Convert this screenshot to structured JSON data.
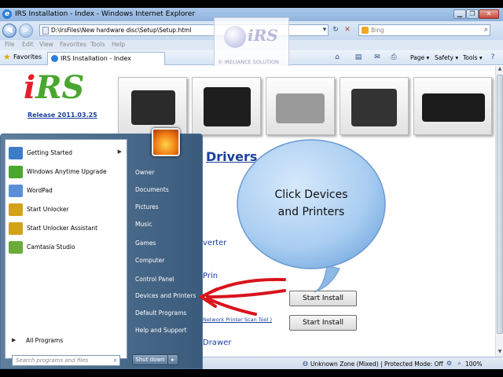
{
  "window": {
    "title": "IRS Installation - Index - Windows Internet Explorer",
    "minimize_glyph": "▁",
    "maximize_glyph": "❐",
    "close_glyph": "✕"
  },
  "address_bar": {
    "url": "D:\\IrsFiles\\New hardware disc\\Setup\\Setup.html",
    "back_glyph": "◀",
    "forward_glyph": "▶",
    "search_placeholder": "Bing"
  },
  "menu": [
    "File",
    "Edit",
    "View",
    "Favorites",
    "Tools",
    "Help"
  ],
  "favorites_bar": {
    "favorites_label": "Favorites",
    "tab_label": "IRS Installation - Index",
    "commands": [
      "Page ▾",
      "Safety ▾",
      "Tools ▾"
    ]
  },
  "watermark": {
    "brand": "iRS",
    "subtitle": "© IRELIANCE SOLUTION"
  },
  "page": {
    "logo_i": "i",
    "logo_rs": "RS",
    "release": "Release 2011.03.25",
    "heading": "Drivers",
    "converter_text": "verter",
    "printer_text": "Prin",
    "install_button_1": "Start Install",
    "install_button_2": "Start Install",
    "network_link": "Network Printer Scan Tool )",
    "drawer_text": "Drawer"
  },
  "callout": {
    "line1": "Click Devices",
    "line2": "and Printers"
  },
  "start_menu": {
    "programs": [
      {
        "label": "Getting Started",
        "has_arrow": true,
        "icon_color": "#3d7cc9"
      },
      {
        "label": "Windows Anytime Upgrade",
        "has_arrow": false,
        "icon_color": "#4aa72e"
      },
      {
        "label": "WordPad",
        "has_arrow": false,
        "icon_color": "#5a8fd6"
      },
      {
        "label": "Start Unlocker",
        "has_arrow": false,
        "icon_color": "#d4a11a"
      },
      {
        "label": "Start Unlocker Assistant",
        "has_arrow": false,
        "icon_color": "#d4a11a"
      },
      {
        "label": "Camtasia Studio",
        "has_arrow": false,
        "icon_color": "#6aab3a"
      }
    ],
    "submenu_arrow": "▶",
    "all_programs": "All Programs",
    "search_placeholder": "Search programs and files",
    "right_items": [
      "Owner",
      "Documents",
      "Pictures",
      "Music",
      "Games",
      "Computer",
      "Control Panel",
      "Devices and Printers",
      "Default Programs",
      "Help and Support"
    ],
    "shutdown": "Shut down",
    "shutdown_arrow": "▸"
  },
  "status_bar": {
    "zone": "Unknown Zone (Mixed) | Protected Mode: Off",
    "zoom": "100%"
  }
}
